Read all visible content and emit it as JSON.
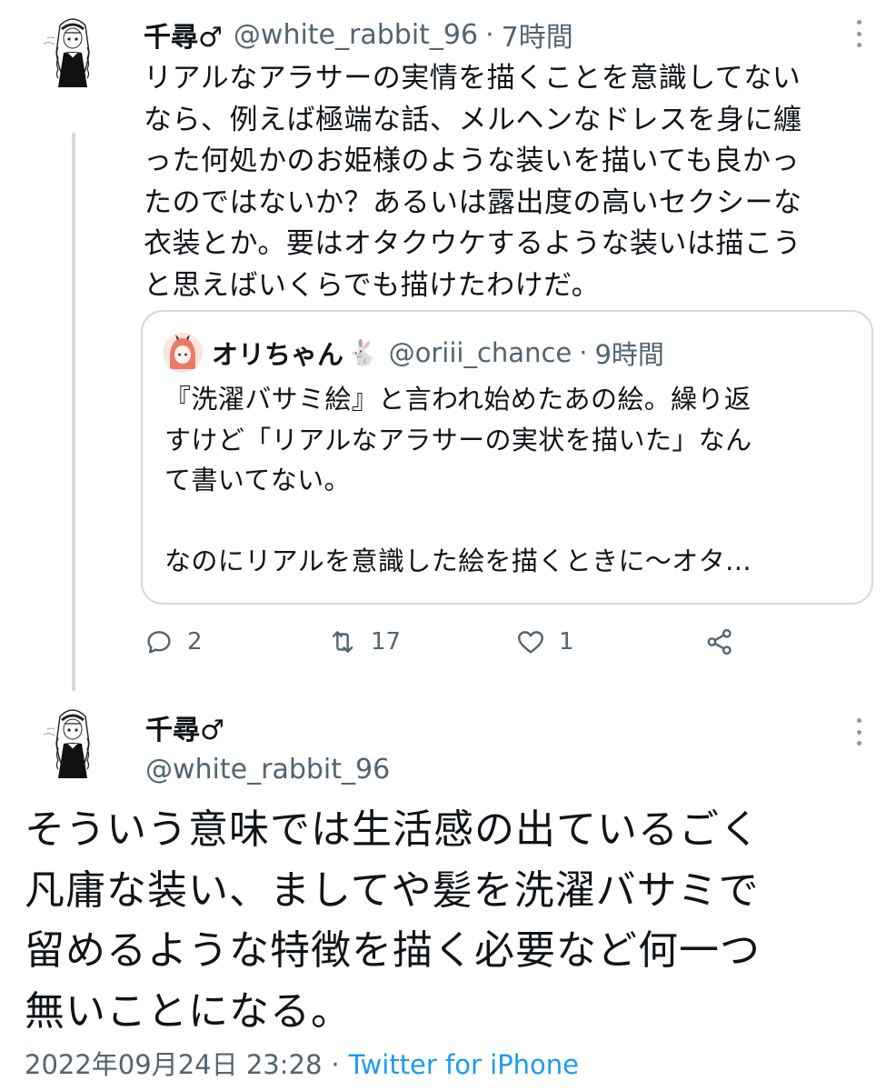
{
  "tweet1": {
    "display_name": "千尋♂",
    "handle": "@white_rabbit_96",
    "separator": "·",
    "time": "7時間",
    "text_lines": [
      "リアルなアラサーの実情を描くことを意識してない",
      "なら、例えば極端な話、メルヘンなドレスを身に纏",
      "った何処かのお姫様のような装いを描いても良かっ",
      "たのではないか？あるいは露出度の高いセクシーな",
      "衣装とか。要はオタクウケするような装いは描こう",
      "と思えばいくらでも描けたわけだ。"
    ],
    "more_icon": "more-dots-icon"
  },
  "quote": {
    "display_name": "オリちゃん",
    "emoji": "🐇",
    "handle": "@oriii_chance",
    "separator": "·",
    "time": "9時間",
    "text_lines": [
      "『洗濯バサミ絵』と言われ始めたあの絵。繰り返",
      "すけど「リアルなアラサーの実状を描いた」なん",
      "て書いてない。",
      "",
      "なのにリアルを意識した絵を描くときに〜オタ..."
    ]
  },
  "actions": {
    "reply_count": "2",
    "retweet_count": "17",
    "like_count": "1",
    "icons": [
      "reply-icon",
      "retweet-icon",
      "like-icon",
      "share-icon"
    ]
  },
  "tweet2": {
    "display_name": "千尋♂",
    "handle": "@white_rabbit_96",
    "text_lines": [
      "そういう意味では生活感の出ているごく",
      "凡庸な装い、ましてや髪を洗濯バサミで",
      "留めるような特徴を描く必要など何一つ",
      "無いことになる。"
    ],
    "timestamp": "2022年09月24日 23:28",
    "separator": "·",
    "source": "Twitter for iPhone"
  },
  "colors": {
    "text": "#0f1419",
    "secondary": "#536471",
    "link": "#1d9bf0",
    "border": "#cfd9de"
  }
}
